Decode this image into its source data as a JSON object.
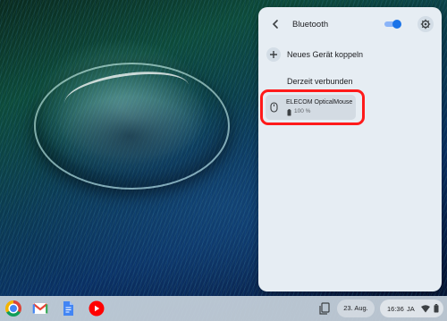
{
  "bluetooth_panel": {
    "title": "Bluetooth",
    "toggle_on": true,
    "pair_label": "Neues Gerät koppeln",
    "section_label": "Derzeit verbunden",
    "devices": [
      {
        "name": "ELECOM OpticalMouse",
        "battery": "100 %"
      }
    ]
  },
  "shelf": {
    "apps": [
      "Chrome",
      "Gmail",
      "Docs",
      "YouTube"
    ],
    "date": "23. Aug.",
    "time": "16:36",
    "language": "JA"
  },
  "colors": {
    "accent": "#1a73e8",
    "panel_bg": "#e6edf3",
    "highlight": "#ff1a1a"
  }
}
